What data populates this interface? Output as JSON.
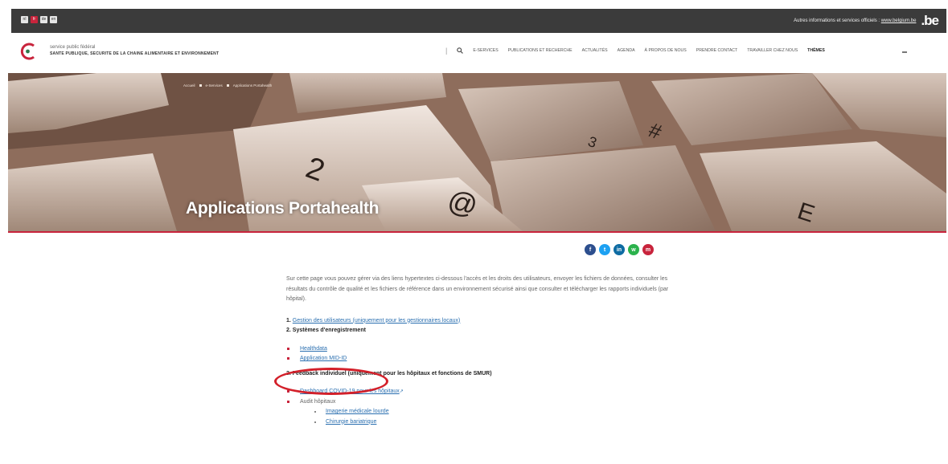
{
  "topbar": {
    "languages": [
      "nl",
      "fr",
      "de",
      "en"
    ],
    "active_language_index": 1,
    "info_text": "Autres informations et services officiels :",
    "info_link": "www.belgium.be",
    "be_logo": ".be"
  },
  "header": {
    "org_line1": "service public fédéral",
    "org_line2": "SANTE PUBLIQUE, SECURITE DE LA CHAINE ALIMENTAIRE ET ENVIRONNEMENT",
    "nav": [
      "E-SERVICES",
      "PUBLICATIONS ET RECHERCHE",
      "ACTUALITÉS",
      "AGENDA",
      "À PROPOS DE NOUS",
      "PRENDRE CONTACT",
      "TRAVAILLER CHEZ NOUS",
      "THÈMES"
    ]
  },
  "hero": {
    "breadcrumb": [
      "Accueil",
      "e-Services",
      "Applications Portahealth"
    ],
    "title": "Applications Portahealth"
  },
  "social": {
    "icons": [
      "f",
      "t",
      "in",
      "w",
      "m"
    ],
    "colors": [
      "#2d4f8e",
      "#1da1f2",
      "#0e6ca3",
      "#2bb24c",
      "#c8243c"
    ]
  },
  "content": {
    "intro": "Sur cette page vous pouvez gérer via des liens hypertextes ci-dessous l'accès et les droits des utilisateurs, envoyer les fichiers de données, consulter les résultats du contrôle de qualité et les fichiers de référence dans un environnement sécurisé ainsi que consulter et télécharger les rapports individuels (par hôpital).",
    "item1_num": "1.",
    "item1_link": "Gestion des utilisateurs (uniquement pour les gestionnaires locaux)",
    "item2_title": "2. Systèmes d'enregistrement",
    "item2_links": [
      "Healthdata",
      "Application MID-ID"
    ],
    "item3_title": "3. Feedback individuel (uniquement pour les hôpitaux et fonctions de SMUR)",
    "item3_link1": "Dashboard COVID-19 pour les hôpitaux",
    "item3_ext": "↗",
    "item3_text2": "Audit hôpitaux",
    "item3_sub": [
      "Imagerie médicale lourde",
      "Chirurgie bariatrique"
    ]
  }
}
